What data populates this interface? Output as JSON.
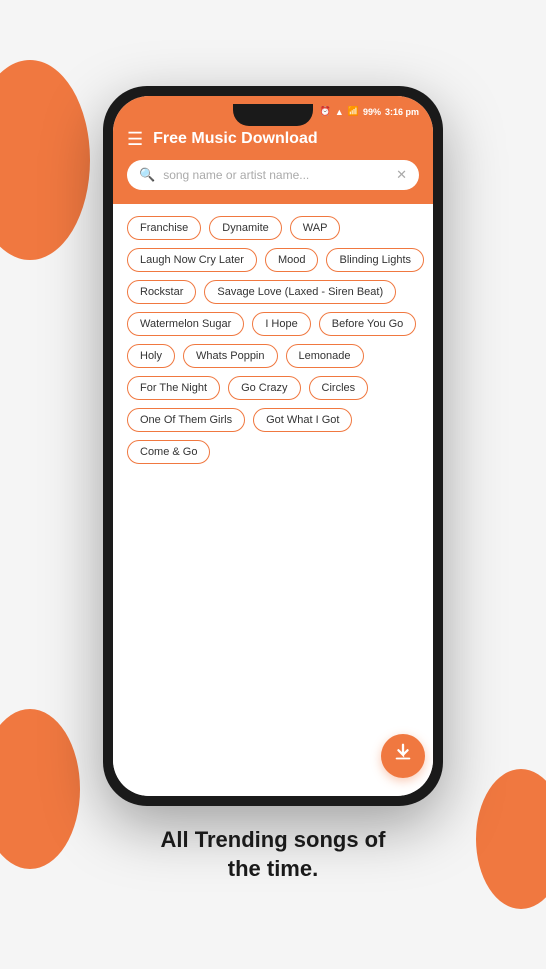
{
  "background": {
    "color": "#f5f5f5"
  },
  "status_bar": {
    "battery": "99%",
    "time": "3:16 pm",
    "icons": "📶🔋"
  },
  "header": {
    "title": "Free Music Download",
    "menu_icon": "☰"
  },
  "search": {
    "placeholder": "song name or artist name...",
    "clear_icon": "✕"
  },
  "tags": [
    [
      "Franchise",
      "Dynamite",
      "WAP"
    ],
    [
      "Laugh Now Cry Later",
      "Mood",
      "Blinding Lights"
    ],
    [
      "Rockstar",
      "Savage Love (Laxed - Siren Beat)"
    ],
    [
      "Watermelon Sugar",
      "I Hope",
      "Before You Go"
    ],
    [
      "Holy",
      "Whats Poppin",
      "Lemonade"
    ],
    [
      "For The Night",
      "Go Crazy",
      "Circles"
    ],
    [
      "One Of Them Girls",
      "Got What I Got"
    ],
    [
      "Come & Go"
    ]
  ],
  "fab": {
    "icon": "⬇",
    "label": "download-fab"
  },
  "bottom_text": "All Trending songs of\nthe time."
}
